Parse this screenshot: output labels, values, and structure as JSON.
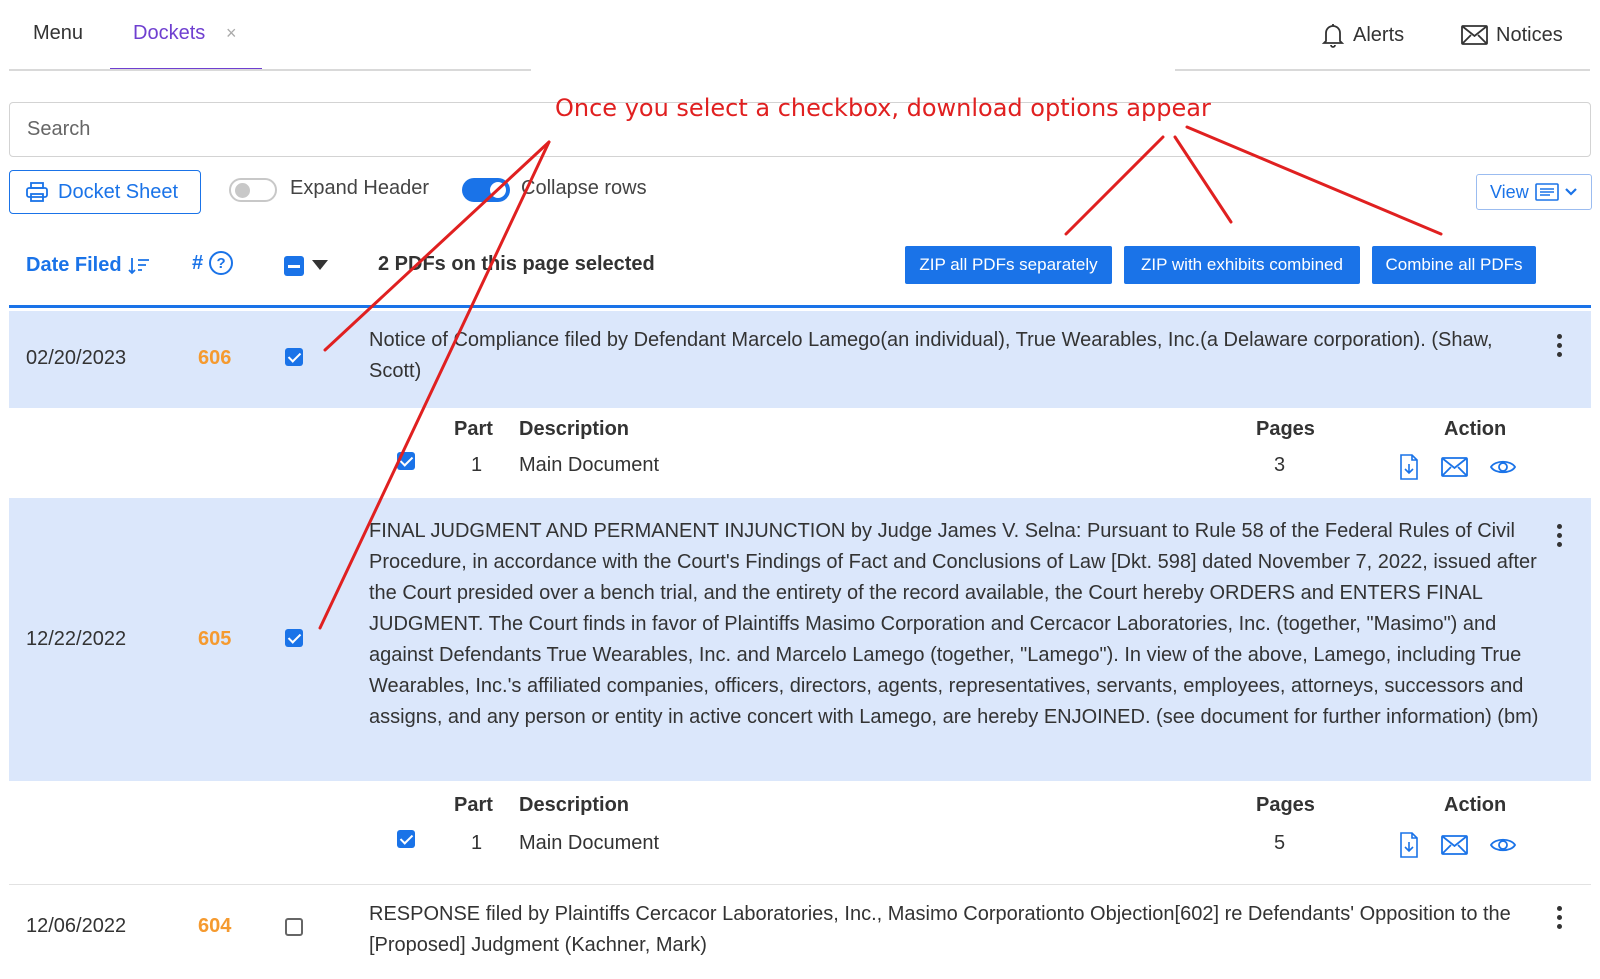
{
  "nav": {
    "menu_label": "Menu",
    "dockets_label": "Dockets",
    "close_symbol": "×",
    "alerts_label": "Alerts",
    "notices_label": "Notices"
  },
  "search": {
    "placeholder": "Search"
  },
  "toolbar": {
    "docket_sheet_label": "Docket Sheet",
    "expand_header_label": "Expand Header",
    "expand_header_on": false,
    "collapse_rows_label": "Collapse rows",
    "collapse_rows_on": true,
    "view_label": "View"
  },
  "table_header": {
    "date_filed": "Date Filed",
    "number": "#",
    "help_symbol": "?",
    "selection_status": "2 PDFs on this page selected",
    "zip_separately": "ZIP all PDFs separately",
    "zip_combined": "ZIP with exhibits combined",
    "combine_all": "Combine all PDFs"
  },
  "entries": [
    {
      "date": "02/20/2023",
      "number": "606",
      "checked": true,
      "text": "Notice of Compliance filed by Defendant Marcelo Lamego(an individual), True Wearables, Inc.(a Delaware corporation). (Shaw, Scott)",
      "sub_header": {
        "part": "Part",
        "description": "Description",
        "pages": "Pages",
        "action": "Action"
      },
      "parts": [
        {
          "part": "1",
          "description": "Main Document",
          "pages": "3",
          "checked": true
        }
      ]
    },
    {
      "date": "12/22/2022",
      "number": "605",
      "checked": true,
      "text": "FINAL JUDGMENT AND PERMANENT INJUNCTION by Judge James V. Selna: Pursuant to Rule 58 of the Federal Rules of Civil Procedure, in accordance with the Court's Findings of Fact and Conclusions of Law [Dkt. 598] dated November 7, 2022, issued after the Court presided over a bench trial, and the entirety of the record available, the Court hereby ORDERS and ENTERS FINAL JUDGMENT. The Court finds in favor of Plaintiffs Masimo Corporation and Cercacor Laboratories, Inc. (together, \"Masimo\") and against Defendants True Wearables, Inc. and Marcelo Lamego (together, \"Lamego\"). In view of the above, Lamego, including True Wearables, Inc.'s affiliated companies, officers, directors, agents, representatives, servants, employees, attorneys, successors and assigns, and any person or entity in active concert with Lamego, are hereby ENJOINED. (see document for further information) (bm)",
      "sub_header": {
        "part": "Part",
        "description": "Description",
        "pages": "Pages",
        "action": "Action"
      },
      "parts": [
        {
          "part": "1",
          "description": "Main Document",
          "pages": "5",
          "checked": true
        }
      ]
    },
    {
      "date": "12/06/2022",
      "number": "604",
      "checked": false,
      "text": "RESPONSE filed by Plaintiffs Cercacor Laboratories, Inc., Masimo Corporationto Objection[602] re Defendants' Opposition to the [Proposed] Judgment (Kachner, Mark)"
    }
  ],
  "annotation": {
    "text": "Once you select a checkbox, download options appear",
    "color": "#e02020"
  },
  "colors": {
    "accent": "#1a73e8",
    "tab_active": "#6f3fd0",
    "docket_number": "#f59a2f",
    "row_highlight": "#dbe7fb"
  },
  "icons": [
    "bell-icon",
    "envelope-icon",
    "printer-icon",
    "list-icon",
    "chevron-down-icon",
    "sort-icon",
    "help-icon",
    "kebab-icon",
    "download-file-icon",
    "mail-icon",
    "eye-icon"
  ]
}
